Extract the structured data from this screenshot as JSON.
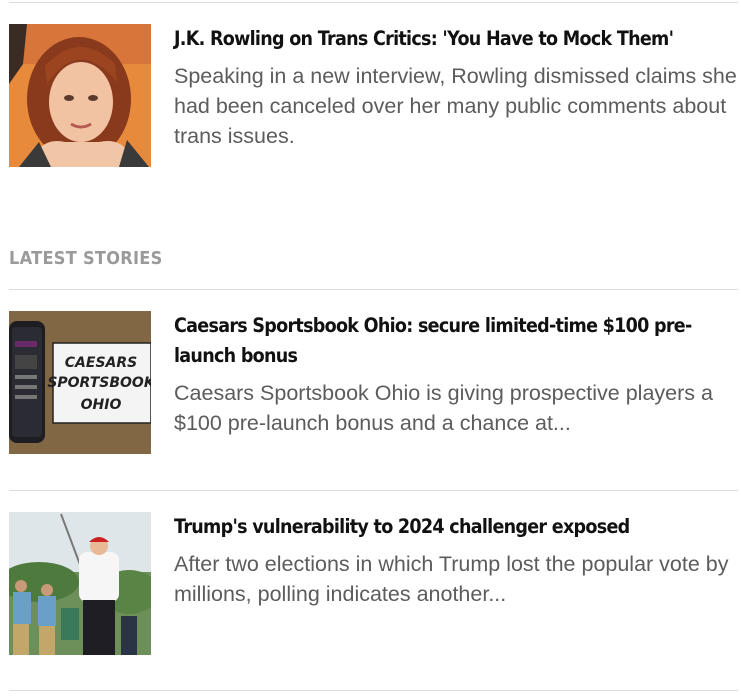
{
  "top_story": {
    "headline": "J.K. Rowling on Trans Critics: 'You Have to Mock Them'",
    "summary": "Speaking in a new interview, Rowling dismissed claims she had been canceled over her many public comments about trans issues."
  },
  "latest": {
    "label": "LATEST STORIES",
    "stories": [
      {
        "headline": "Caesars Sportsbook Ohio: secure limited-time $100 pre-launch bonus",
        "summary": "Caesars Sportsbook Ohio is giving prospective players a $100 pre-launch bonus and a chance at...",
        "thumb_text": [
          "CAESARS",
          "SPORTSBOOK",
          "OHIO"
        ]
      },
      {
        "headline": "Trump's vulnerability to 2024 challenger exposed",
        "summary": "After two elections in which Trump lost the popular vote by millions, polling indicates another..."
      }
    ]
  }
}
